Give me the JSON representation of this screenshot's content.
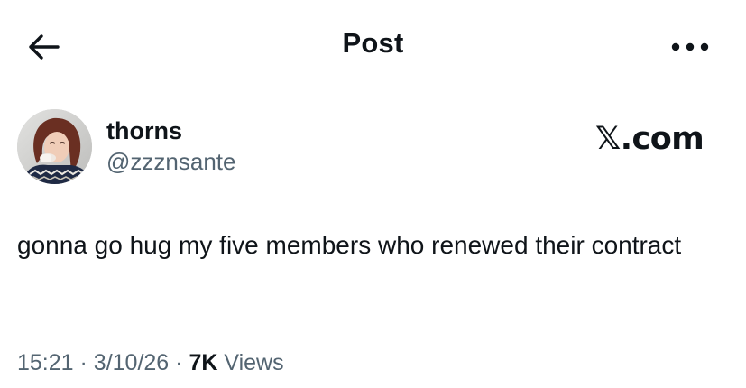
{
  "header": {
    "title": "Post",
    "back_icon": "arrow-left-icon",
    "more_icon": "more-horizontal-icon"
  },
  "author": {
    "display_name": "thorns",
    "handle": "@zzznsante",
    "avatar_icon": "profile-photo"
  },
  "watermark": "𝕏.com",
  "post": {
    "text": "gonna go hug my five members who renewed their contract"
  },
  "meta": {
    "time": "15:21",
    "separator": "·",
    "date": "3/10/26",
    "views_count": "7K",
    "views_label": "Views"
  },
  "colors": {
    "text_primary": "#0f1419",
    "text_secondary": "#536471",
    "background": "#ffffff"
  }
}
